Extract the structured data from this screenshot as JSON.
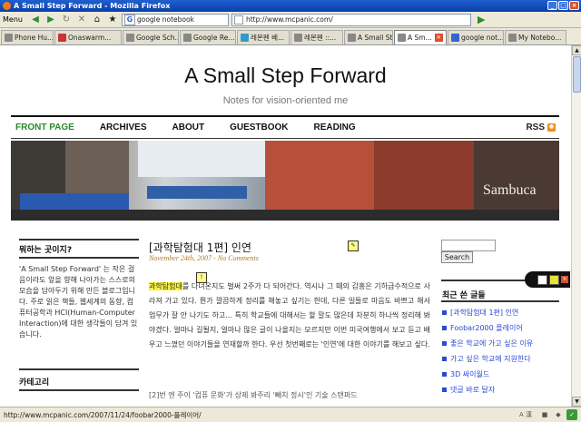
{
  "window": {
    "title": "A Small Step Forward - Mozilla Firefox"
  },
  "toolbar": {
    "menu_label": "Menu",
    "search_value": "google notebook",
    "url": "http://www.mcpanic.com/"
  },
  "tabs": [
    {
      "label": "Phone Hu...",
      "active": false
    },
    {
      "label": "Onaswarm...",
      "active": false
    },
    {
      "label": "Google Sch...",
      "active": false
    },
    {
      "label": "Google Re...",
      "active": false
    },
    {
      "label": "레몬펜 베...",
      "active": false
    },
    {
      "label": "레몬펜 ::...",
      "active": false
    },
    {
      "label": "A Small Ste...",
      "active": false
    },
    {
      "label": "A Sm...",
      "active": true
    },
    {
      "label": "google not...",
      "active": false
    },
    {
      "label": "My Notebo...",
      "active": false
    }
  ],
  "site": {
    "title": "A Small Step Forward",
    "tagline": "Notes for vision-oriented me"
  },
  "nav": {
    "items": [
      "FRONT PAGE",
      "ARCHIVES",
      "ABOUT",
      "GUESTBOOK",
      "READING"
    ],
    "rss": "RSS"
  },
  "banner": {
    "sign": "Sambuca"
  },
  "sidebar": {
    "heading1": "뭐하는 곳이지?",
    "intro": "'A Small Step Forward' 는 작은 걸음이라도 앞을 향해 나아가는 스스로의 모습을 담아두기 위해 만든 블로그입니다. 주로 읽은 책들, 웹세계의 동향, 컴퓨터공학과 HCI(Human-Computer Interaction)에 대한 생각들이 담겨 있습니다.",
    "heading2": "카테고리"
  },
  "post": {
    "title": "[과학탐험대 1편] 인연",
    "meta": "November 24th, 2007 - No Comments",
    "highlight": "과학탐험대",
    "body": "를 다녀온지도 벌써 2주가 다 되어간다. 역시나 그 때의 감흥은 기하급수적으로 사라져 가고 있다. 뭔가 깔끔하게 정리를 해놓고 싶기는 한데, 다른 일들로 마음도 바쁘고 해서 업무가 잘 안 나기도 하고... 특히 학교들에 대해서는 할 말도 많은데 차분히 하나씩 정리해 봐야겠다. 얼마나 길될지, 얼마나 많은 글이 나올지는 모르지만 이번 미국여행에서 보고 듣고 배우고 느꼈던 이야기들을 연재할까 한다. 우선 첫번째로는 '인연'에 대한 이야기를 해보고 싶다.",
    "next_line": "[2]번 엔 주이 '컴퓨 문화'가 상제 봐주리 '빼치 정시'인 기술 스탠퍼드"
  },
  "right": {
    "search_button": "Search",
    "recent_heading": "최근 쓴 글들",
    "recent": [
      "[과학탐험대 1편] 인연",
      "Foobar2000 플레이어",
      "좋은 학교에 가고 싶은 이유",
      "가고 싶은 학교에 지원한다",
      "3D 싸이월드",
      "댓글 바로 달자"
    ]
  },
  "status": {
    "text": "http://www.mcpanic.com/2007/11/24/foobar2000-플레이어/",
    "ime": "A 漢"
  }
}
